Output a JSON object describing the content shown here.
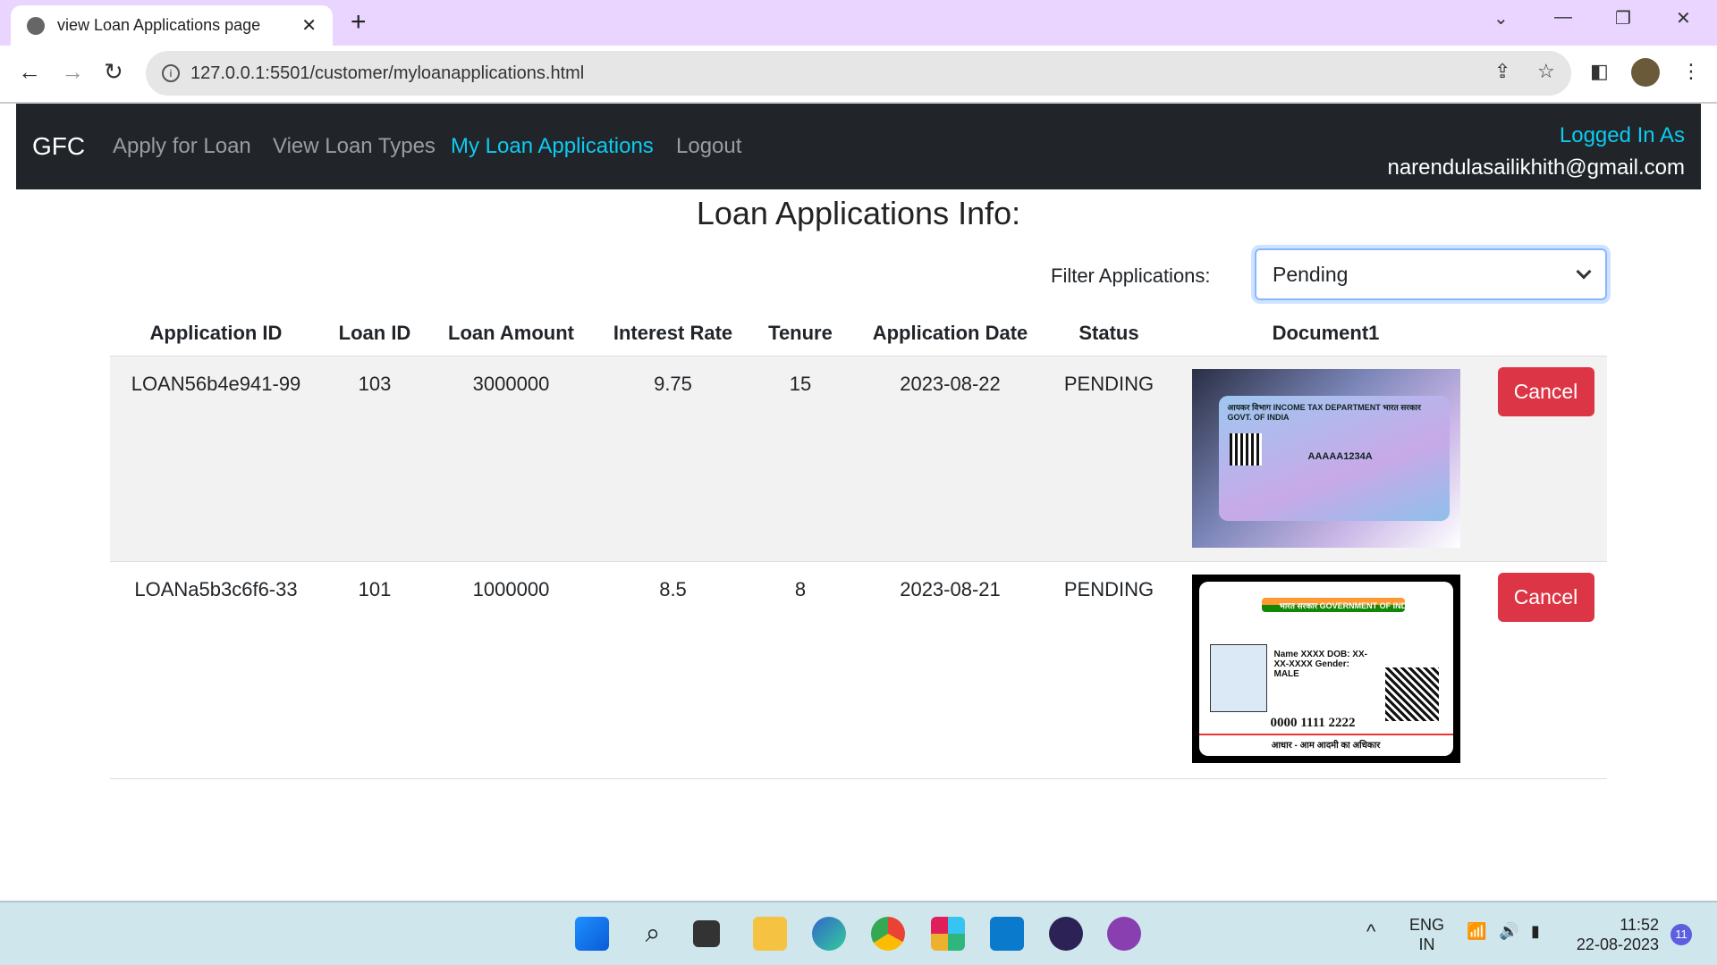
{
  "browser": {
    "tab_title": "view Loan Applications page",
    "url": "127.0.0.1:5501/customer/myloanapplications.html"
  },
  "navbar": {
    "brand": "GFC",
    "links": [
      {
        "label": "Apply for Loan",
        "active": false
      },
      {
        "label": "View Loan Types",
        "active": false
      },
      {
        "label": "My Loan Applications",
        "active": true
      },
      {
        "label": "Logout",
        "active": false
      }
    ],
    "logged_in_label": "Logged In As",
    "user_email": "narendulasailikhith@gmail.com",
    "accent": "#0dcaf0"
  },
  "page": {
    "title": "Loan Applications Info:",
    "filter_label": "Filter Applications:",
    "filter_value": "Pending"
  },
  "table": {
    "headers": [
      "Application ID",
      "Loan ID",
      "Loan Amount",
      "Interest Rate",
      "Tenure",
      "Application Date",
      "Status",
      "Document1",
      ""
    ],
    "rows": [
      {
        "application_id": "LOAN56b4e941-99",
        "loan_id": "103",
        "amount": "3000000",
        "rate": "9.75",
        "tenure": "15",
        "date": "2023-08-22",
        "status": "PENDING",
        "document": "pan-card-image",
        "action": "Cancel"
      },
      {
        "application_id": "LOANa5b3c6f6-33",
        "loan_id": "101",
        "amount": "1000000",
        "rate": "8.5",
        "tenure": "8",
        "date": "2023-08-21",
        "status": "PENDING",
        "document": "aadhaar-card-image",
        "action": "Cancel"
      }
    ]
  },
  "doc_text": {
    "pan_head": "आयकर विभाग  INCOME TAX DEPARTMENT   भारत सरकार GOVT. OF INDIA",
    "pan_number": "AAAAA1234A",
    "aadhaar_head": "भारत सरकार GOVERNMENT OF INDIA",
    "aadhaar_details": "Name XXXX DOB: XX-XX-XXXX Gender: MALE",
    "aadhaar_number": "0000 1111 2222",
    "aadhaar_tagline": "आधार - आम आदमी का अधिकार"
  },
  "taskbar": {
    "lang_top": "ENG",
    "lang_bottom": "IN",
    "time": "11:52",
    "date": "22-08-2023",
    "notifications": "11"
  },
  "colors": {
    "danger": "#dc3545",
    "navbar_bg": "#212529",
    "tab_bar": "#e9d5ff"
  }
}
